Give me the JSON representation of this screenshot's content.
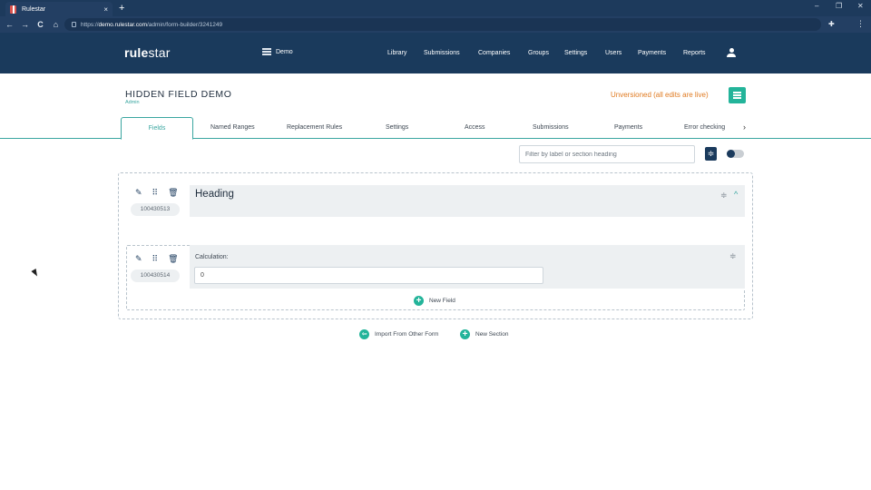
{
  "browser": {
    "tab_title": "Rulestar",
    "tab_close": "×",
    "new_tab": "+",
    "url_scheme": "https://",
    "url_host": "demo.rulestar.com",
    "url_path": "/admin/form-builder/3241249",
    "win_min": "–",
    "win_max": "❐",
    "win_close": "✕",
    "back": "←",
    "forward": "→",
    "reload": "C",
    "home": "⌂",
    "extensions": "✚",
    "menu": "⋮"
  },
  "header": {
    "logo_bold": "rule",
    "logo_light": "star",
    "environment": "Demo",
    "nav": [
      {
        "label": "Library"
      },
      {
        "label": "Submissions"
      },
      {
        "label": "Companies"
      },
      {
        "label": "Groups"
      },
      {
        "label": "Settings"
      },
      {
        "label": "Users"
      },
      {
        "label": "Payments"
      },
      {
        "label": "Reports"
      }
    ]
  },
  "page": {
    "title": "HIDDEN FIELD DEMO",
    "subtitle": "Admin",
    "version_status": "Unversioned (all edits are live)"
  },
  "tabs": [
    {
      "label": "Fields",
      "active": true
    },
    {
      "label": "Named Ranges"
    },
    {
      "label": "Replacement Rules"
    },
    {
      "label": "Settings"
    },
    {
      "label": "Access"
    },
    {
      "label": "Submissions"
    },
    {
      "label": "Payments"
    },
    {
      "label": "Error checking"
    }
  ],
  "tabs_next": "›",
  "filter": {
    "placeholder": "Filter by label or section heading",
    "collapse_glyph": "≑"
  },
  "section": {
    "id": "100430513",
    "heading": "Heading",
    "handle_glyph": "≑",
    "chevron_glyph": "^"
  },
  "field": {
    "id": "100430514",
    "label": "Calculation:",
    "value": "0",
    "handle_glyph": "≑"
  },
  "tools": {
    "edit": "✎",
    "move": "⠿",
    "delete": "🗑"
  },
  "actions": {
    "new_field": "New Field",
    "import": "Import From Other Form",
    "new_section": "New Section",
    "plus": "+",
    "import_glyph": "⇦"
  },
  "colors": {
    "header_bg": "#1a3a5c",
    "accent": "#3aa6a0",
    "button_green": "#23b49a",
    "warning": "#e07b22"
  }
}
